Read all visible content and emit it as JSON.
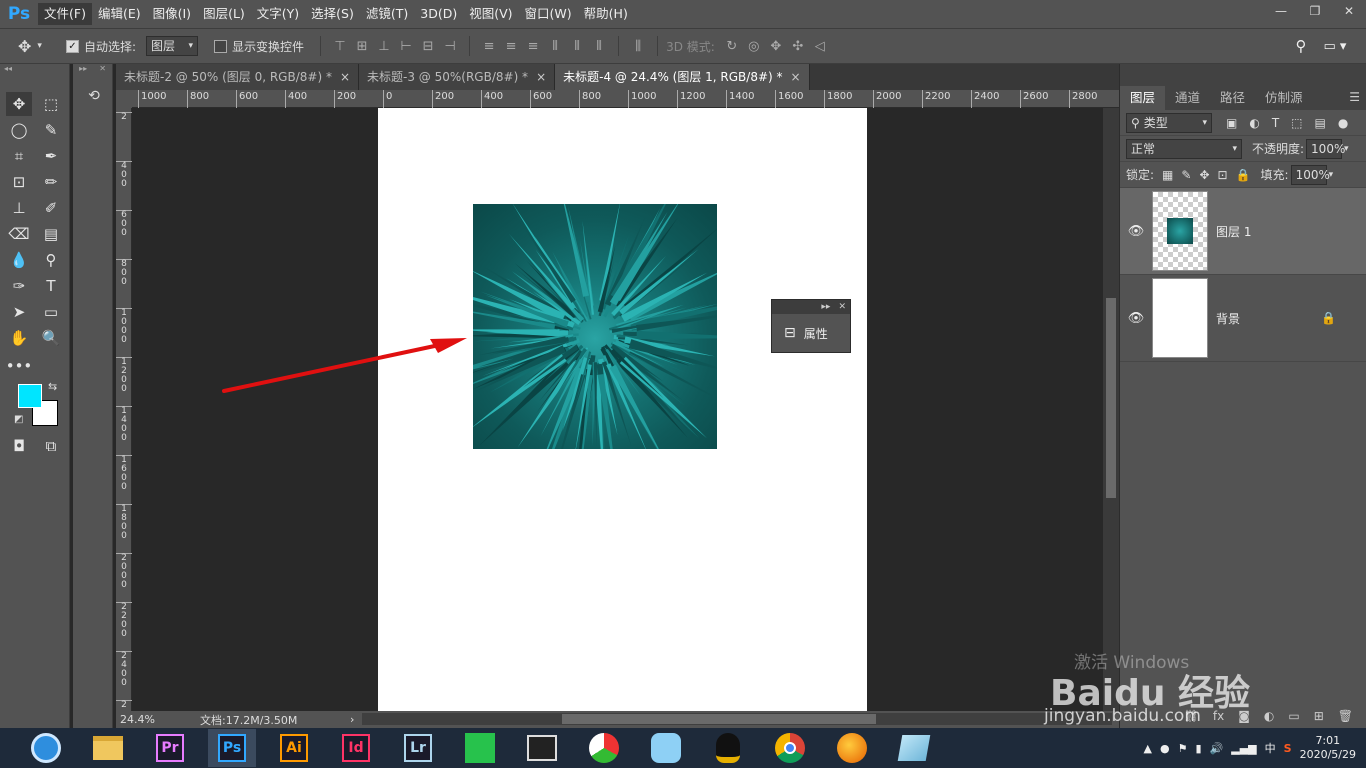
{
  "menubar": {
    "logo": "Ps",
    "items": [
      "文件(F)",
      "编辑(E)",
      "图像(I)",
      "图层(L)",
      "文字(Y)",
      "选择(S)",
      "滤镜(T)",
      "3D(D)",
      "视图(V)",
      "窗口(W)",
      "帮助(H)"
    ],
    "window_controls": [
      "—",
      "❐",
      "✕"
    ]
  },
  "options": {
    "auto_select_label": "自动选择:",
    "auto_select_value": "图层",
    "show_transform_label": "显示变换控件",
    "mode_3d_label": "3D 模式:"
  },
  "tabs": [
    {
      "label": "未标题-2 @ 50% (图层 0, RGB/8#) *",
      "close": "×"
    },
    {
      "label": "未标题-3 @ 50%(RGB/8#) *",
      "close": "×"
    },
    {
      "label": "未标题-4 @ 24.4% (图层 1, RGB/8#) *",
      "close": "×"
    }
  ],
  "ruler": {
    "h_ticks": [
      "1000",
      "800",
      "600",
      "400",
      "200",
      "0",
      "200",
      "400",
      "600",
      "800",
      "1000",
      "1200",
      "1400",
      "1600",
      "1800",
      "2000",
      "2200",
      "2400",
      "2600",
      "2800"
    ],
    "v_ticks": [
      "2",
      "400",
      "600",
      "800",
      "1000",
      "1200",
      "1400",
      "1600",
      "1800",
      "2000",
      "2200",
      "2400",
      "2"
    ]
  },
  "status": {
    "zoom": "24.4%",
    "doc_size": "文档:17.2M/3.50M",
    "arrow": "›"
  },
  "properties_panel": {
    "label": "属性"
  },
  "layers_panel": {
    "tabs": [
      "图层",
      "通道",
      "路径",
      "仿制源"
    ],
    "filter_kind": "类型",
    "blend_mode": "正常",
    "opacity_label": "不透明度:",
    "opacity_value": "100%",
    "lock_label": "锁定:",
    "fill_label": "填充:",
    "fill_value": "100%",
    "layers": [
      {
        "name": "图层 1",
        "selected": true
      },
      {
        "name": "背景",
        "selected": false
      }
    ]
  },
  "watermark": {
    "line1": "激活 Windows",
    "line2": "Baidu 经验",
    "line3": "jingyan.baidu.com"
  },
  "taskbar": {
    "apps": [
      {
        "name": "Pr",
        "color": "#e77cff"
      },
      {
        "name": "Ps",
        "color": "#31a8ff"
      },
      {
        "name": "Ai",
        "color": "#ff9a00"
      },
      {
        "name": "Id",
        "color": "#ff3366"
      },
      {
        "name": "Lr",
        "color": "#add5ec"
      }
    ],
    "ime": "中",
    "time": "7:01",
    "date": "2020/5/29"
  },
  "colors": {
    "foreground": "#00e5ff",
    "background": "#ffffff",
    "arrow": "#e01010"
  }
}
